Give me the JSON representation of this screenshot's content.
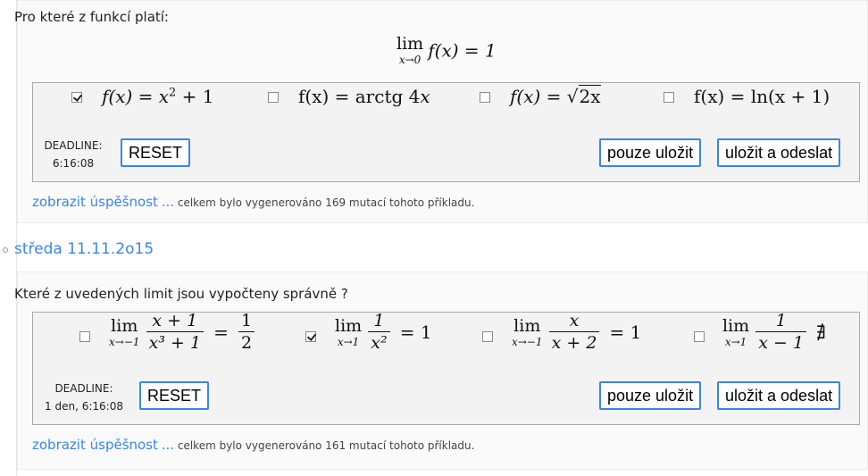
{
  "ui": {
    "accent": "#3a85e8",
    "box_border": "#a9a9a9"
  },
  "task1": {
    "question": "Pro které z funkcí platí:",
    "main_formula": {
      "lim_word": "lim",
      "lim_sub": "x→0",
      "body": "f(x) = 1"
    },
    "options": [
      {
        "checked": true,
        "lhs": "f(x) = x",
        "sup": "2",
        "rhs": " + 1"
      },
      {
        "checked": false,
        "lhs": "f(x) = arctg 4",
        "var": "x"
      },
      {
        "checked": false,
        "lhs": "f(x) = ",
        "sqrt": "2x"
      },
      {
        "checked": false,
        "lhs": "f(x) = ln(x + 1)"
      }
    ],
    "deadline_label": "DEADLINE:",
    "deadline_value": "6:16:08",
    "reset_label": "RESET",
    "save_label": "pouze uložit",
    "submit_label": "uložit a odeslat",
    "footer_link": "zobrazit úspěšnost",
    "footer_dots": "...",
    "footer_text": "celkem bylo vygenerováno 169 mutací tohoto příkladu."
  },
  "date_label": "středa 11.11.2o15",
  "task2": {
    "question": "Které z uvedených limit jsou vypočteny správně ?",
    "options": [
      {
        "checked": false,
        "lim": "lim",
        "sub": "x→−1",
        "num": "x + 1",
        "den": "x³ + 1",
        "eq": "=",
        "rnum": "1",
        "rden": "2"
      },
      {
        "checked": true,
        "lim": "lim",
        "sub": "x→1",
        "num": "1",
        "den": "x²",
        "eq": "= 1"
      },
      {
        "checked": false,
        "lim": "lim",
        "sub": "x→−1",
        "num": "x",
        "den": "x + 2",
        "eq": "= 1"
      },
      {
        "checked": false,
        "lim": "lim",
        "sub": "x→1",
        "num": "1",
        "den": "x − 1",
        "eq": "∄"
      }
    ],
    "deadline_label": "DEADLINE:",
    "deadline_value": "1 den, 6:16:08",
    "reset_label": "RESET",
    "save_label": "pouze uložit",
    "submit_label": "uložit a odeslat",
    "footer_link": "zobrazit úspěšnost",
    "footer_dots": "...",
    "footer_text": "celkem bylo vygenerováno 161 mutací tohoto příkladu."
  }
}
